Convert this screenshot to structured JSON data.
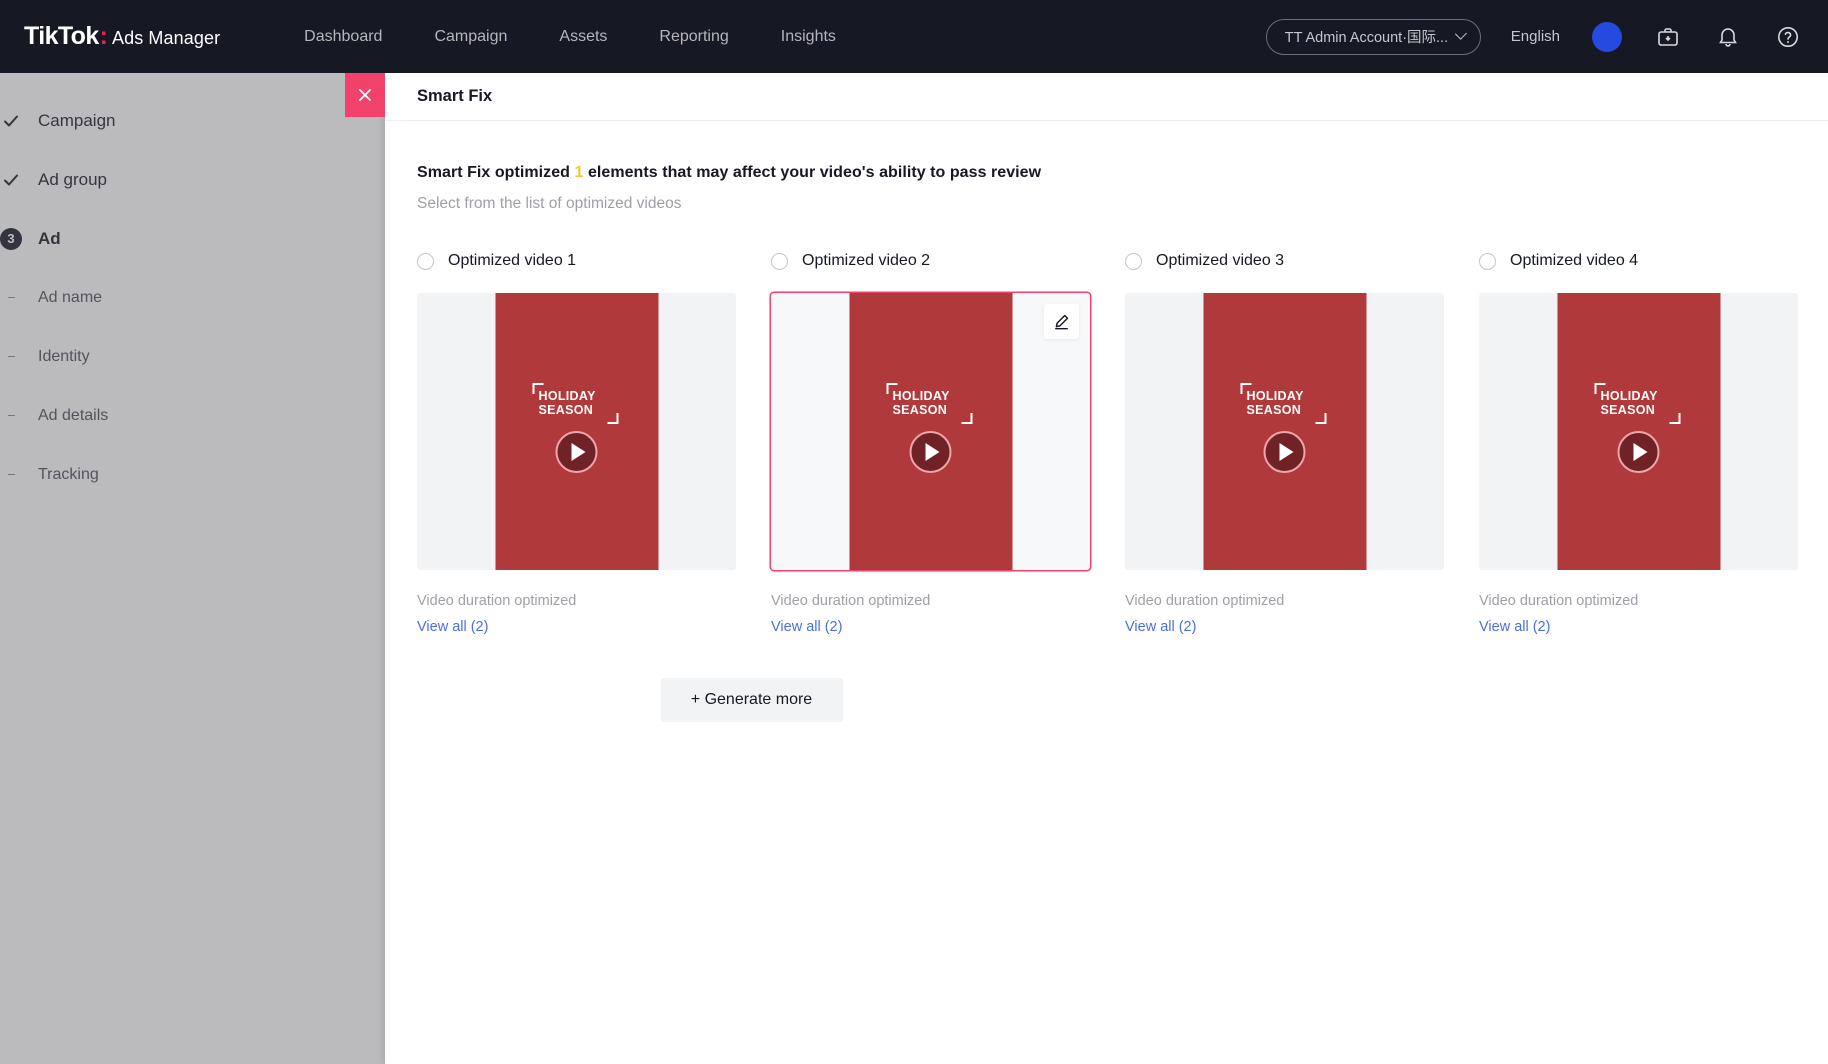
{
  "topnav": {
    "brand_name": "TikTok",
    "brand_colon": ":",
    "brand_product": "Ads Manager",
    "links": [
      {
        "label": "Dashboard"
      },
      {
        "label": "Campaign"
      },
      {
        "label": "Assets"
      },
      {
        "label": "Reporting"
      },
      {
        "label": "Insights"
      }
    ],
    "account_selector": "TT Admin Account·国际...",
    "language": "English",
    "icons": [
      "avatar",
      "briefcase-icon",
      "bell-icon",
      "help-icon"
    ]
  },
  "wizard": {
    "steps": [
      {
        "label": "Campaign",
        "state": "done",
        "marker": "check"
      },
      {
        "label": "Ad group",
        "state": "done",
        "marker": "check"
      },
      {
        "label": "Ad",
        "state": "current",
        "marker": "3"
      }
    ],
    "sub_steps": [
      {
        "label": "Ad name"
      },
      {
        "label": "Identity"
      },
      {
        "label": "Ad details"
      },
      {
        "label": "Tracking"
      }
    ]
  },
  "drawer": {
    "title": "Smart Fix",
    "close_label": "Close",
    "lead_before": "Smart Fix optimized",
    "lead_count": "1",
    "lead_after": "elements that may affect your video's ability to pass review",
    "sublead": "Select from the list of optimized videos",
    "generate_more_label": "+ Generate more",
    "accent_color": "#f2416b",
    "count_color": "#f5c63c",
    "link_color": "#4a6fe3"
  },
  "cards": [
    {
      "title": "Optimized video 1",
      "selected": false,
      "has_edit": false,
      "overlay_line1": "HOLIDAY",
      "overlay_line2": "SEASON",
      "caption": "Video duration optimized",
      "link": "View all (2)"
    },
    {
      "title": "Optimized video 2",
      "selected": true,
      "has_edit": true,
      "overlay_line1": "HOLIDAY",
      "overlay_line2": "SEASON",
      "caption": "Video duration optimized",
      "link": "View all (2)"
    },
    {
      "title": "Optimized video 3",
      "selected": false,
      "has_edit": false,
      "overlay_line1": "HOLIDAY",
      "overlay_line2": "SEASON",
      "caption": "Video duration optimized",
      "link": "View all (2)"
    },
    {
      "title": "Optimized video 4",
      "selected": false,
      "has_edit": false,
      "overlay_line1": "HOLIDAY",
      "overlay_line2": "SEASON",
      "caption": "Video duration optimized",
      "link": "View all (2)"
    }
  ]
}
